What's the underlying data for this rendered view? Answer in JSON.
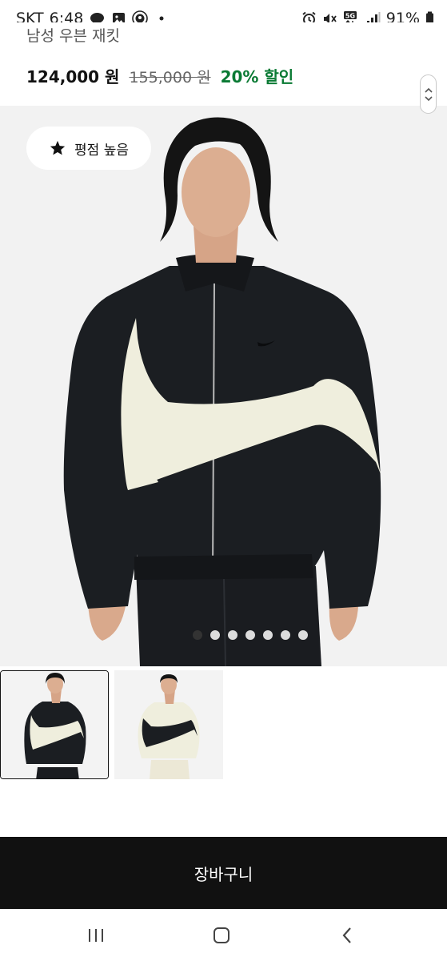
{
  "status_bar": {
    "carrier": "SKT",
    "time": "6:48",
    "network": "5G",
    "battery": "91%",
    "left_icons": [
      "chat-bubble-icon",
      "gallery-icon",
      "starbucks-icon",
      "dot-icon"
    ],
    "right_icons": [
      "alarm-icon",
      "mute-icon",
      "network-icon",
      "signal-icon",
      "battery-icon"
    ]
  },
  "product": {
    "name": "남성 우븐 재킷",
    "price": "124,000 원",
    "original_price": "155,000 원",
    "discount": "20% 할인"
  },
  "hero": {
    "badge_label": "평점 높음",
    "badge_icon": "star-icon",
    "image_count": 7,
    "active_index": 0
  },
  "thumbnails": [
    {
      "name": "thumb-black",
      "selected": true
    },
    {
      "name": "thumb-cream",
      "selected": false
    }
  ],
  "cart": {
    "button_label": "장바구니"
  },
  "nav": [
    "recent-apps-icon",
    "home-icon",
    "back-icon"
  ],
  "colors": {
    "discount": "#0a7a34",
    "cart_bg": "#111111",
    "hero_bg": "#f2f2f2",
    "jacket_black": "#1b1e22",
    "swoosh_cream": "#efeedd"
  }
}
